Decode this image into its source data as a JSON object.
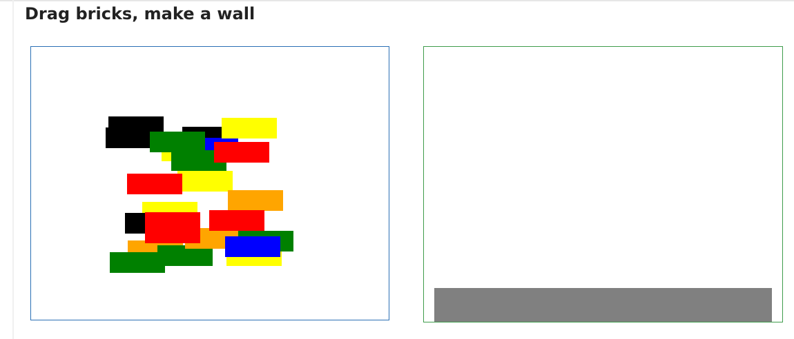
{
  "page": {
    "title": "Drag bricks, make a wall"
  },
  "colors": {
    "pile_border": "#2a6fb4",
    "wall_border": "#3e9c4b",
    "ground": "#808080"
  },
  "bricks": [
    {
      "color": "black"
    },
    {
      "color": "black"
    },
    {
      "color": "black"
    },
    {
      "color": "yellow"
    },
    {
      "color": "blue"
    },
    {
      "color": "yellow"
    },
    {
      "color": "green"
    },
    {
      "color": "green"
    },
    {
      "color": "red"
    },
    {
      "color": "yellow"
    },
    {
      "color": "red"
    },
    {
      "color": "orange"
    },
    {
      "color": "yellow"
    },
    {
      "color": "black"
    },
    {
      "color": "red"
    },
    {
      "color": "orange"
    },
    {
      "color": "yellow"
    },
    {
      "color": "green"
    },
    {
      "color": "orange"
    },
    {
      "color": "green"
    },
    {
      "color": "red"
    },
    {
      "color": "red"
    },
    {
      "color": "blue"
    },
    {
      "color": "green"
    }
  ]
}
